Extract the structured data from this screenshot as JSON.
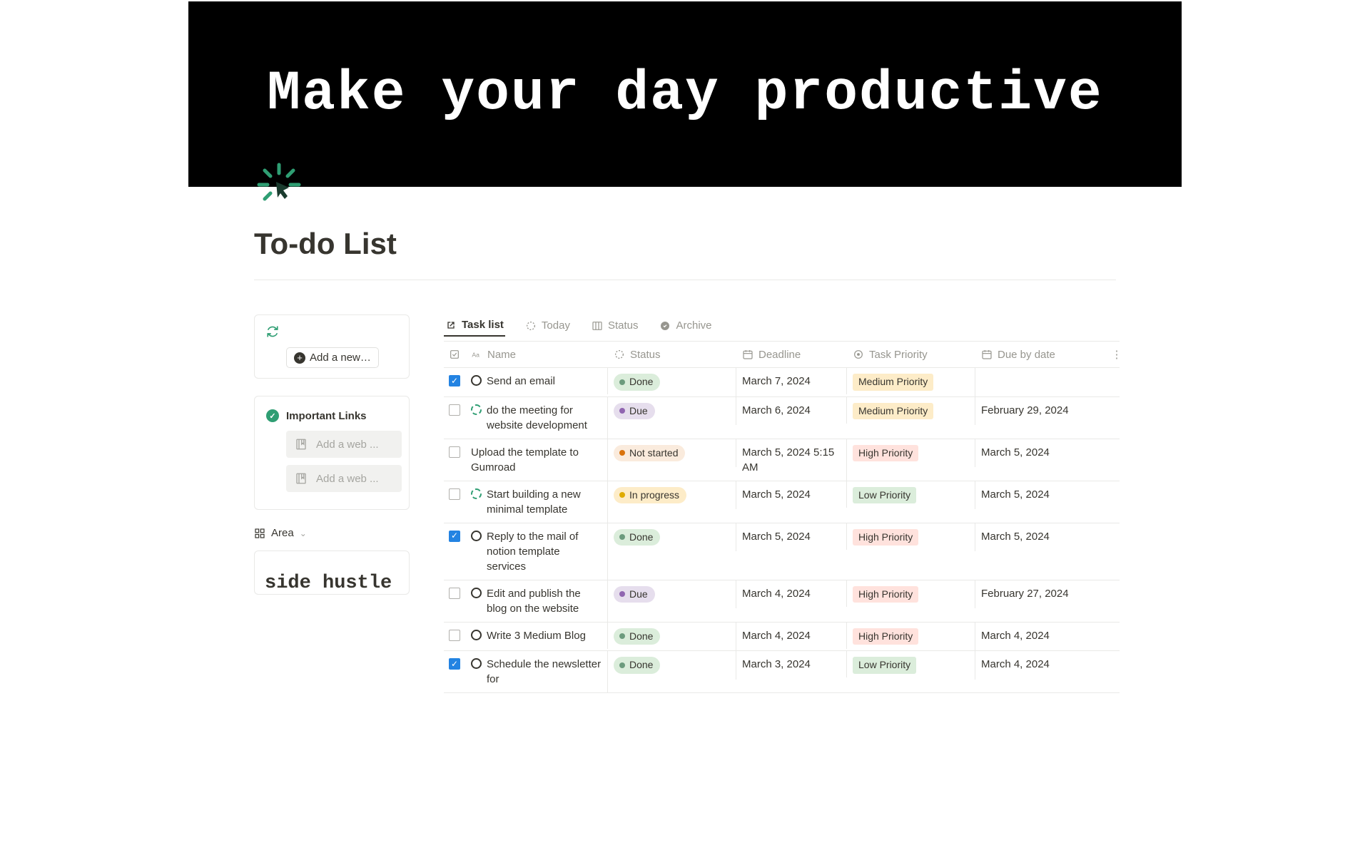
{
  "hero": {
    "text": "Make your day productive"
  },
  "page": {
    "title": "To-do List"
  },
  "sidebar": {
    "add_button_label": "Add a new t...",
    "links_title": "Important Links",
    "web_placeholder": "Add a web ...",
    "area_label": "Area",
    "side_hustle_label": "side hustle"
  },
  "tabs": [
    {
      "label": "Task list",
      "icon": "open-icon",
      "active": true
    },
    {
      "label": "Today",
      "icon": "dashed-circle-icon",
      "active": false
    },
    {
      "label": "Status",
      "icon": "board-icon",
      "active": false
    },
    {
      "label": "Archive",
      "icon": "check-circle-icon",
      "active": false
    }
  ],
  "columns": [
    {
      "label": "",
      "icon": "checkbox-header-icon"
    },
    {
      "label": "Name",
      "icon": "text-aa-icon"
    },
    {
      "label": "Status",
      "icon": "dashed-circle-icon"
    },
    {
      "label": "Deadline",
      "icon": "calendar-icon"
    },
    {
      "label": "Task Priority",
      "icon": "target-icon"
    },
    {
      "label": "Due by date",
      "icon": "calendar-icon"
    }
  ],
  "rows": [
    {
      "checked": true,
      "ring": "solid",
      "name": "Send an email",
      "status": "Done",
      "status_class": "done",
      "deadline": "March 7, 2024",
      "priority": "Medium Priority",
      "priority_class": "medium",
      "due": ""
    },
    {
      "checked": false,
      "ring": "dashed",
      "name": "do the meeting for website development",
      "status": "Due",
      "status_class": "due",
      "deadline": "March 6, 2024",
      "priority": "Medium Priority",
      "priority_class": "medium",
      "due": "February 29, 2024"
    },
    {
      "checked": false,
      "ring": "",
      "name": "Upload the template to Gumroad",
      "status": "Not started",
      "status_class": "notstarted",
      "deadline": "March 5, 2024 5:15 AM",
      "priority": "High Priority",
      "priority_class": "high",
      "due": "March 5, 2024"
    },
    {
      "checked": false,
      "ring": "dashed",
      "name": "Start building a new minimal template",
      "status": "In progress",
      "status_class": "inprogress",
      "deadline": "March 5, 2024",
      "priority": "Low Priority",
      "priority_class": "low",
      "due": "March 5, 2024"
    },
    {
      "checked": true,
      "ring": "solid",
      "name": "Reply to the mail of notion template services",
      "status": "Done",
      "status_class": "done",
      "deadline": "March 5, 2024",
      "priority": "High Priority",
      "priority_class": "high",
      "due": "March 5, 2024"
    },
    {
      "checked": false,
      "ring": "solid",
      "name": "Edit and publish the blog on the website",
      "status": "Due",
      "status_class": "due",
      "deadline": "March 4, 2024",
      "priority": "High Priority",
      "priority_class": "high",
      "due": "February 27, 2024"
    },
    {
      "checked": false,
      "ring": "solid",
      "name": "Write 3 Medium Blog",
      "status": "Done",
      "status_class": "done",
      "deadline": "March 4, 2024",
      "priority": "High Priority",
      "priority_class": "high",
      "due": "March 4, 2024"
    },
    {
      "checked": true,
      "ring": "solid",
      "name": "Schedule the newsletter for",
      "status": "Done",
      "status_class": "done",
      "deadline": "March 3, 2024",
      "priority": "Low Priority",
      "priority_class": "low",
      "due": "March 4, 2024"
    }
  ]
}
